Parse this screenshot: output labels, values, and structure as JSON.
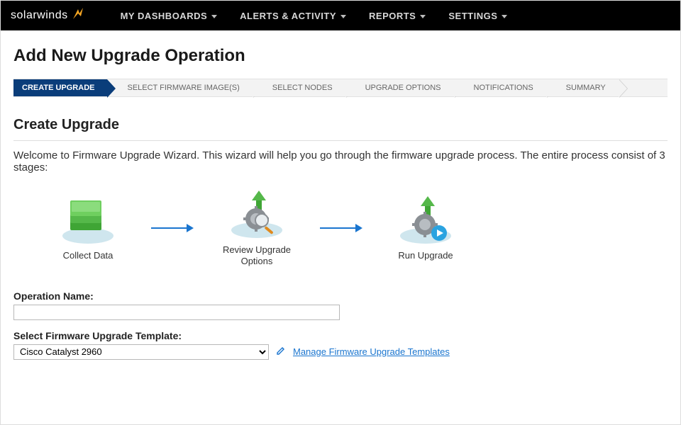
{
  "brand": {
    "name": "solarwinds"
  },
  "nav": {
    "items": [
      {
        "label": "MY DASHBOARDS"
      },
      {
        "label": "ALERTS & ACTIVITY"
      },
      {
        "label": "REPORTS"
      },
      {
        "label": "SETTINGS"
      }
    ]
  },
  "page": {
    "title": "Add New Upgrade Operation"
  },
  "wizard_steps": [
    {
      "label": "CREATE UPGRADE",
      "active": true
    },
    {
      "label": "SELECT FIRMWARE IMAGE(S)",
      "active": false
    },
    {
      "label": "SELECT NODES",
      "active": false
    },
    {
      "label": "UPGRADE OPTIONS",
      "active": false
    },
    {
      "label": "NOTIFICATIONS",
      "active": false
    },
    {
      "label": "SUMMARY",
      "active": false
    }
  ],
  "section": {
    "title": "Create Upgrade",
    "intro": "Welcome to Firmware Upgrade Wizard. This wizard will help you go through the firmware upgrade process. The entire process consist of 3 stages:"
  },
  "stages": [
    {
      "label": "Collect Data"
    },
    {
      "label": "Review Upgrade Options"
    },
    {
      "label": "Run Upgrade"
    }
  ],
  "form": {
    "operation_name": {
      "label": "Operation Name:",
      "value": ""
    },
    "template": {
      "label": "Select Firmware Upgrade Template:",
      "selected": "Cisco Catalyst 2960",
      "manage_link": "Manage Firmware Upgrade Templates"
    }
  }
}
